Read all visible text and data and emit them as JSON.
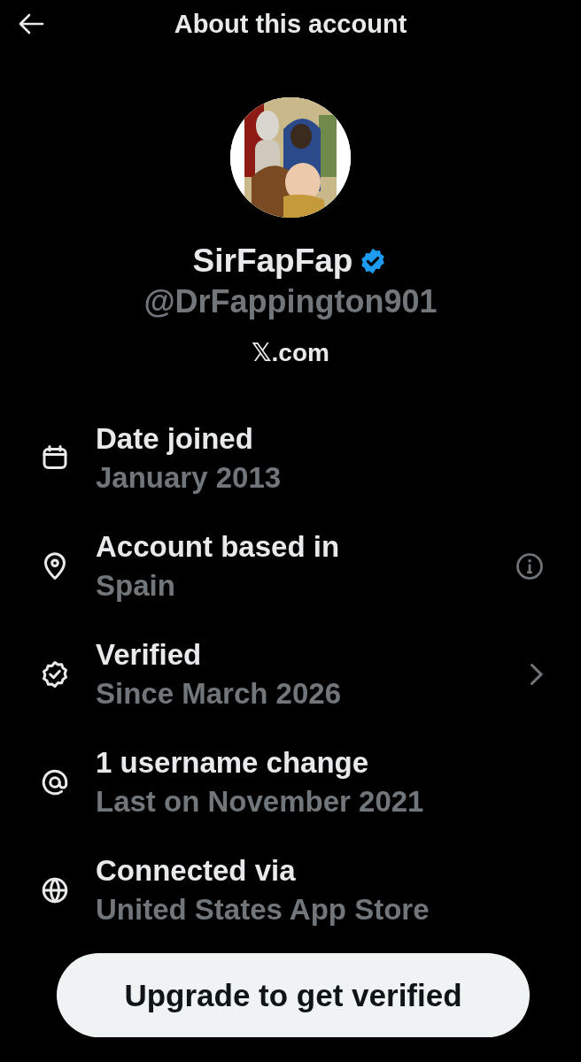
{
  "header": {
    "title": "About this account"
  },
  "profile": {
    "name": "SirFapFap",
    "verified": true,
    "handle": "@DrFappington901",
    "site": "𝕏.com"
  },
  "details": [
    {
      "kind": "calendar",
      "label": "Date joined",
      "value": "January 2013"
    },
    {
      "kind": "location",
      "label": "Account based in",
      "value": "Spain",
      "trailing": {
        "kind": "info"
      }
    },
    {
      "kind": "verified",
      "label": "Verified",
      "value": "Since March 2026",
      "trailing": {
        "kind": "chevron"
      }
    },
    {
      "kind": "at",
      "label": "1 username change",
      "value": "Last on November 2021"
    },
    {
      "kind": "globe",
      "label": "Connected via",
      "value": "United States App Store"
    }
  ],
  "action": {
    "label": "Upgrade to get verified"
  }
}
